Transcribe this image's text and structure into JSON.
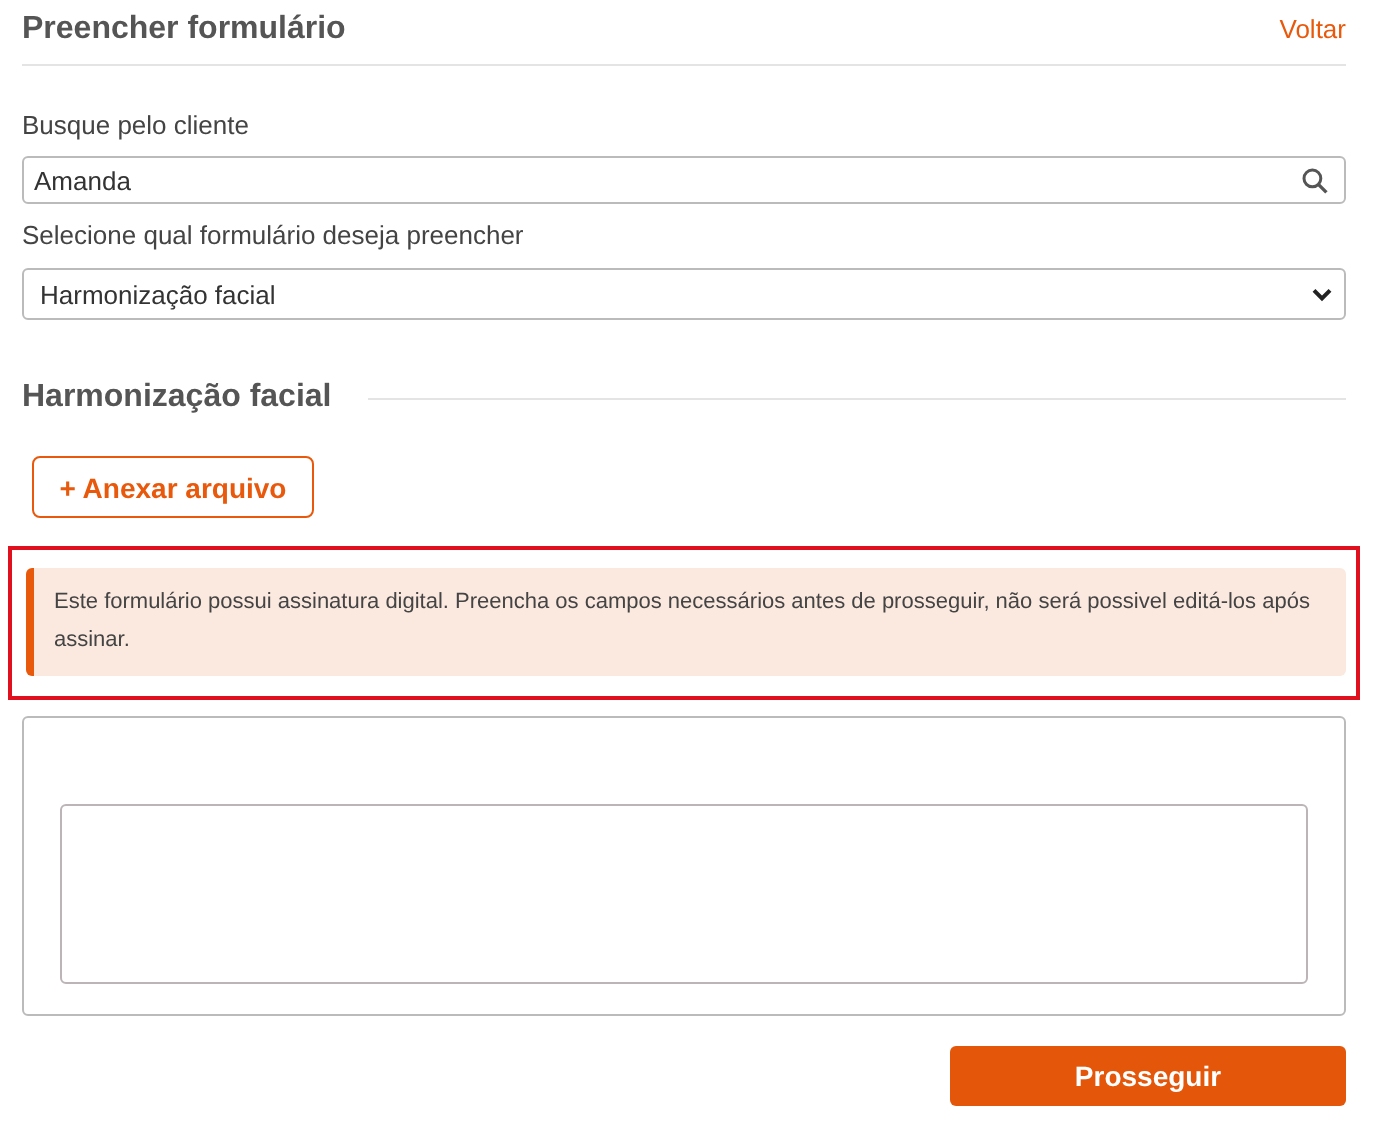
{
  "header": {
    "title": "Preencher formulário",
    "back_link": "Voltar"
  },
  "client_search": {
    "label": "Busque pelo cliente",
    "value": "Amanda"
  },
  "form_select": {
    "label": "Selecione qual formulário deseja preencher",
    "value": "Harmonização facial"
  },
  "section": {
    "title": "Harmonização facial",
    "attach_button": "+ Anexar arquivo"
  },
  "notice": {
    "text": "Este formulário possui assinatura digital. Preencha os campos necessários antes de prosseguir, não será possivel editá-los após assinar.",
    "highlighted": true
  },
  "submit_button": "Prosseguir"
}
